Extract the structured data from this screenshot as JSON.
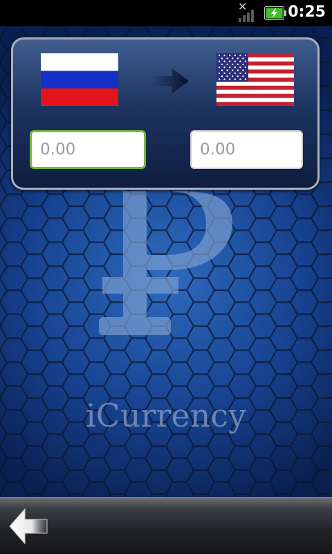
{
  "status_bar": {
    "notification_icon": "✕",
    "signal_icon": "signal-icon",
    "battery_icon": "battery-charging-icon",
    "time": "0:25"
  },
  "app": {
    "name": "iCurrency",
    "emblem_symbol": "₽"
  },
  "converter": {
    "from_currency_flag": "russia-flag",
    "to_currency_flag": "usa-flag",
    "direction_icon": "arrow-right-icon",
    "from_amount": "0.00",
    "to_amount": "0.00"
  },
  "bottom_bar": {
    "back_icon": "back-arrow-icon"
  },
  "colors": {
    "background": "#0f2a5c",
    "accent_focus": "#77b93c",
    "panel_border": "#a9b0ba",
    "battery": "#3fbf2a"
  }
}
